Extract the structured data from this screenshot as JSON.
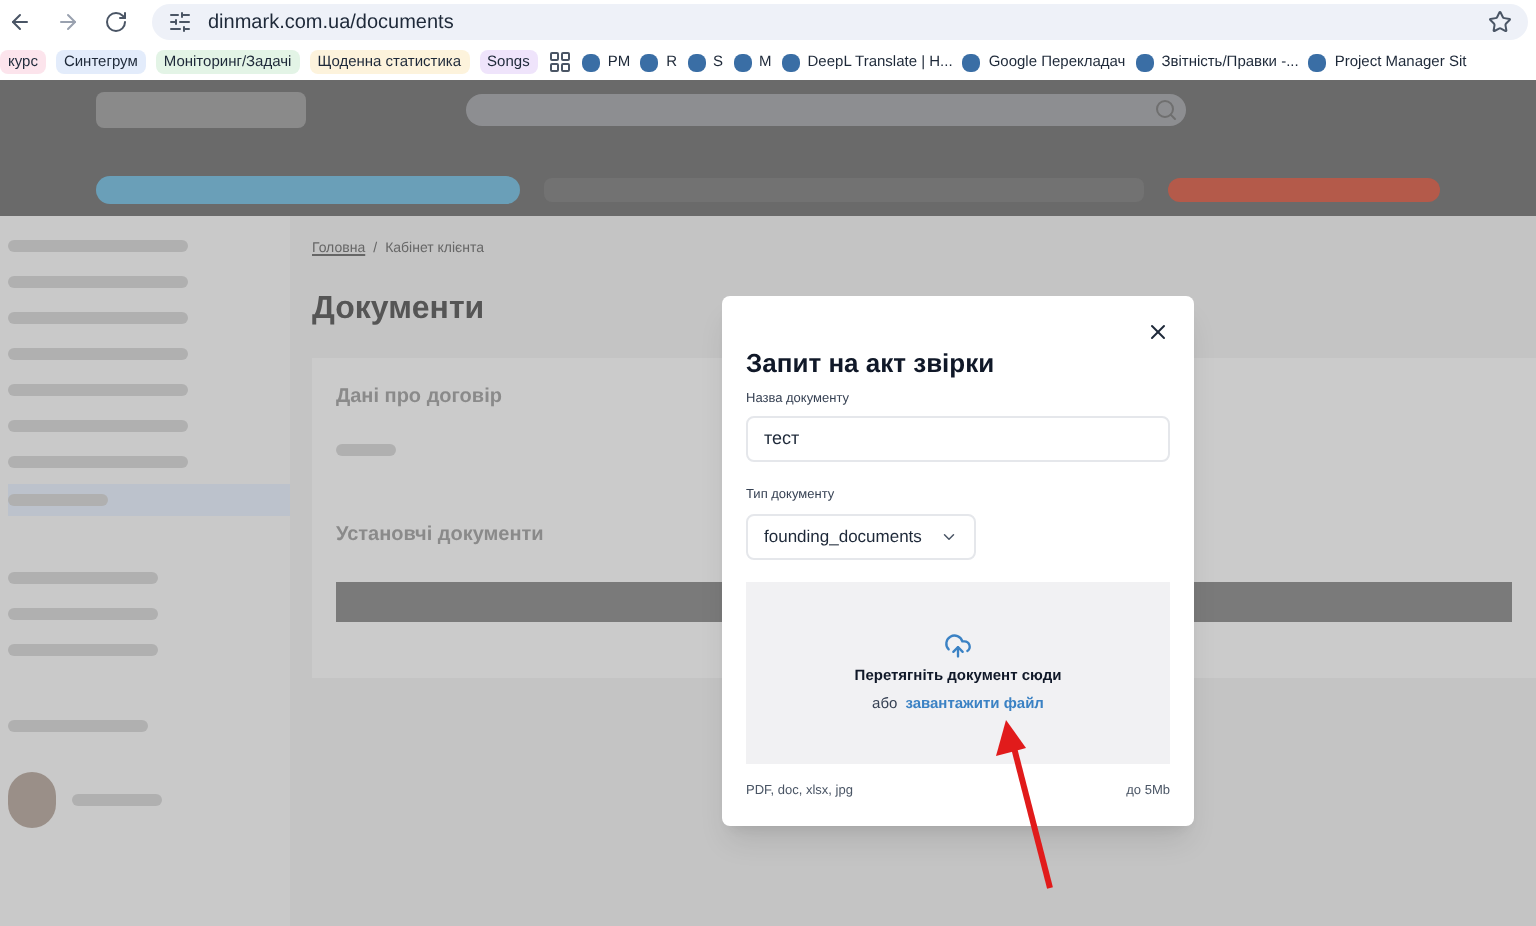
{
  "browser": {
    "url": "dinmark.com.ua/documents",
    "bookmarks": [
      {
        "label": "курс",
        "color": "#fce4ec"
      },
      {
        "label": "Синтегрум",
        "color": "#e3ecfb"
      },
      {
        "label": "Моніторинг/Задачі",
        "color": "#e3f4e6"
      },
      {
        "label": "Щоденна статистика",
        "color": "#fdf3dc"
      },
      {
        "label": "Songs",
        "color": "#efe4fb"
      }
    ],
    "shortcuts": [
      {
        "label": "PM"
      },
      {
        "label": "R"
      },
      {
        "label": "S"
      },
      {
        "label": "M"
      },
      {
        "label": "DeepL Translate | H..."
      },
      {
        "label": "Google Перекладач"
      },
      {
        "label": "Звітність/Правки -..."
      },
      {
        "label": "Project Manager Sit"
      }
    ]
  },
  "page": {
    "breadcrumb": [
      {
        "label": "Головна"
      },
      {
        "label": "Кабінет клієнта"
      }
    ],
    "breadcrumb_separator": "/",
    "title": "Документи",
    "contract_heading": "Дані про договір",
    "documents_heading": "Установчі документи"
  },
  "modal": {
    "title": "Запит на акт звірки",
    "name_label": "Назва документу",
    "name_value": "тест",
    "type_label": "Тип документу",
    "type_value": "founding_documents",
    "drop_text": "Перетягніть документ сюди",
    "drop_prefix": "або",
    "drop_link": "завантажити файл",
    "formats": "PDF, doc, xlsx, jpg",
    "max_size": "до 5Mb"
  }
}
